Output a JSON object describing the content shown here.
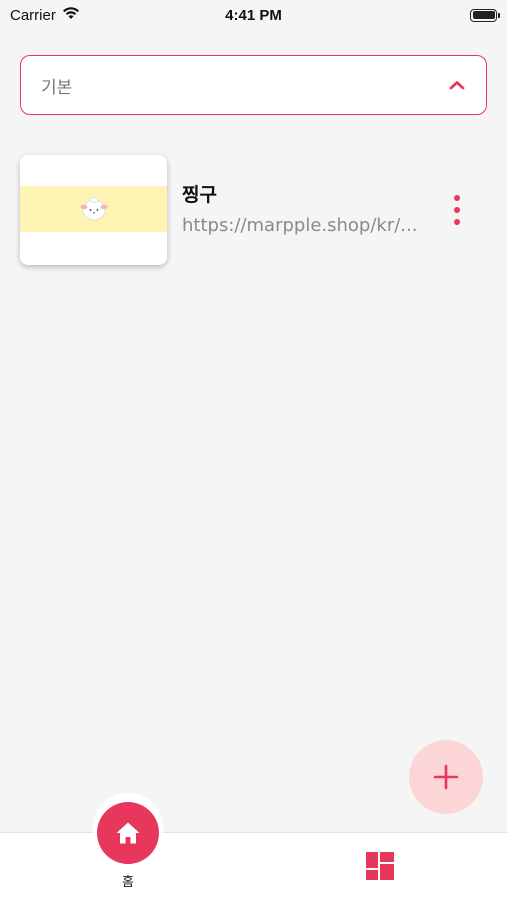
{
  "status_bar": {
    "carrier": "Carrier",
    "time": "4:41 PM",
    "wifi_icon": "wifi-icon",
    "battery_icon": "battery-icon"
  },
  "category_select": {
    "selected": "기본",
    "icon": "chevron-up-icon"
  },
  "links": [
    {
      "title": "찡구",
      "url": "https://marpple.shop/kr/...",
      "thumbnail": "mascot-thumbnail",
      "menu_icon": "more-vertical-icon"
    }
  ],
  "fab": {
    "icon": "plus-icon"
  },
  "bottom_nav": {
    "home_label": "홈",
    "home_icon": "home-icon",
    "grid_icon": "dashboard-icon"
  },
  "colors": {
    "accent": "#e8375c",
    "fab_bg": "#fcd6d6",
    "background": "#f5f5f5",
    "thumb_band": "#fdf3b2"
  }
}
